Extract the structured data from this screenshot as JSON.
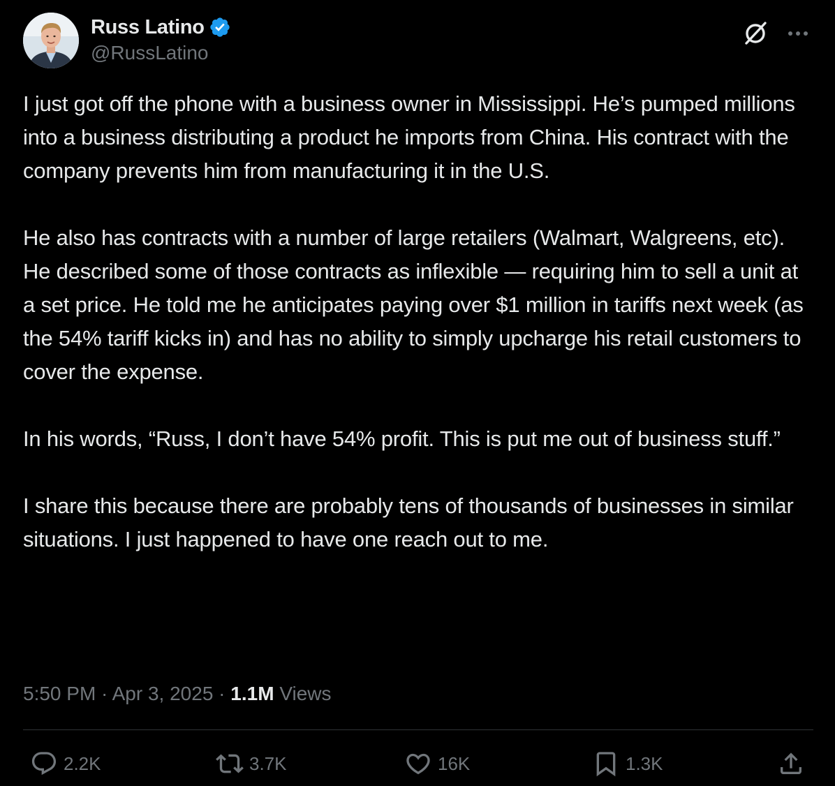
{
  "author": {
    "display_name": "Russ Latino",
    "handle": "@RussLatino",
    "verified": true,
    "verified_color": "#1d9bf0"
  },
  "header_icons": {
    "grok": "grok-slash-circle-icon",
    "more": "more-horizontal-icon"
  },
  "tweet": {
    "paragraphs": [
      "I just got off the phone with a business owner in Mississippi. He’s pumped millions into a business distributing a product he imports from China. His contract with the company prevents him from manufacturing it in the U.S.",
      "He also has contracts with a number of large retailers (Walmart, Walgreens, etc). He described some of those contracts as inflexible — requiring him to sell a unit at a set price. He told me he anticipates paying over $1 million in tariffs next week (as the 54% tariff kicks in) and has no ability to simply upcharge his retail customers to cover the expense.",
      "In his words, “Russ, I don’t have 54% profit. This is put me out of business stuff.”",
      "I share this because there are probably tens of thousands of businesses in similar situations. I just happened to have one reach out to me."
    ]
  },
  "meta": {
    "time": "5:50 PM",
    "separator": " · ",
    "date": "Apr 3, 2025",
    "views_count": "1.1M",
    "views_label": " Views"
  },
  "actions": {
    "replies": "2.2K",
    "reposts": "3.7K",
    "likes": "16K",
    "bookmarks": "1.3K"
  },
  "colors": {
    "background": "#000000",
    "text": "#e7e9ea",
    "secondary": "#71767b",
    "divider": "#2f3336"
  }
}
